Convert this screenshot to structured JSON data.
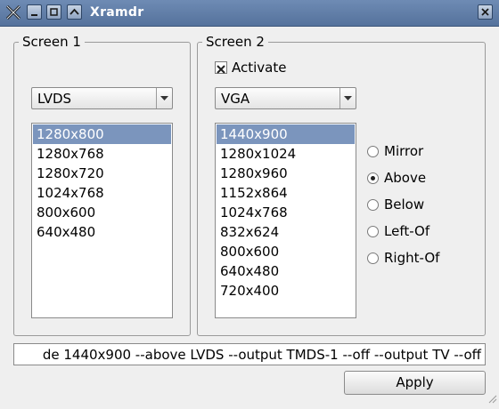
{
  "window": {
    "title": "Xramdr"
  },
  "screen1": {
    "title": "Screen 1",
    "output": "LVDS",
    "modes": [
      "1280x800",
      "1280x768",
      "1280x720",
      "1024x768",
      "800x600",
      "640x480"
    ],
    "selected_index": 0
  },
  "screen2": {
    "title": "Screen 2",
    "activate_label": "Activate",
    "activate_checked": true,
    "output": "VGA",
    "modes": [
      "1440x900",
      "1280x1024",
      "1280x960",
      "1152x864",
      "1024x768",
      "832x624",
      "800x600",
      "640x480",
      "720x400"
    ],
    "selected_index": 0,
    "positions": [
      {
        "label": "Mirror",
        "checked": false
      },
      {
        "label": "Above",
        "checked": true
      },
      {
        "label": "Below",
        "checked": false
      },
      {
        "label": "Left-Of",
        "checked": false
      },
      {
        "label": "Right-Of",
        "checked": false
      }
    ]
  },
  "command": "de 1440x900 --above LVDS --output TMDS-1 --off --output TV --off",
  "apply_label": "Apply"
}
